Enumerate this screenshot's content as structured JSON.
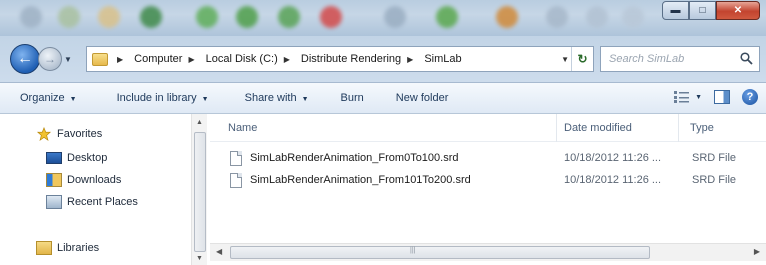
{
  "address": {
    "crumbs": [
      "Computer",
      "Local Disk (C:)",
      "Distribute Rendering",
      "SimLab"
    ]
  },
  "search": {
    "placeholder": "Search SimLab"
  },
  "toolbar": {
    "organize": "Organize",
    "include_in_library": "Include in library",
    "share_with": "Share with",
    "burn": "Burn",
    "new_folder": "New folder"
  },
  "nav": {
    "favorites": "Favorites",
    "desktop": "Desktop",
    "downloads": "Downloads",
    "recent_places": "Recent Places",
    "libraries": "Libraries"
  },
  "columns": {
    "name": "Name",
    "date_modified": "Date modified",
    "type": "Type"
  },
  "files": [
    {
      "name": "SimLabRenderAnimation_From0To100.srd",
      "date": "10/18/2012 11:26 ...",
      "type": "SRD File"
    },
    {
      "name": "SimLabRenderAnimation_From101To200.srd",
      "date": "10/18/2012 11:26 ...",
      "type": "SRD File"
    }
  ],
  "colors": {
    "accent": "#1f5fb4",
    "toolbar_text": "#1e395b",
    "close_button": "#c3442f"
  }
}
